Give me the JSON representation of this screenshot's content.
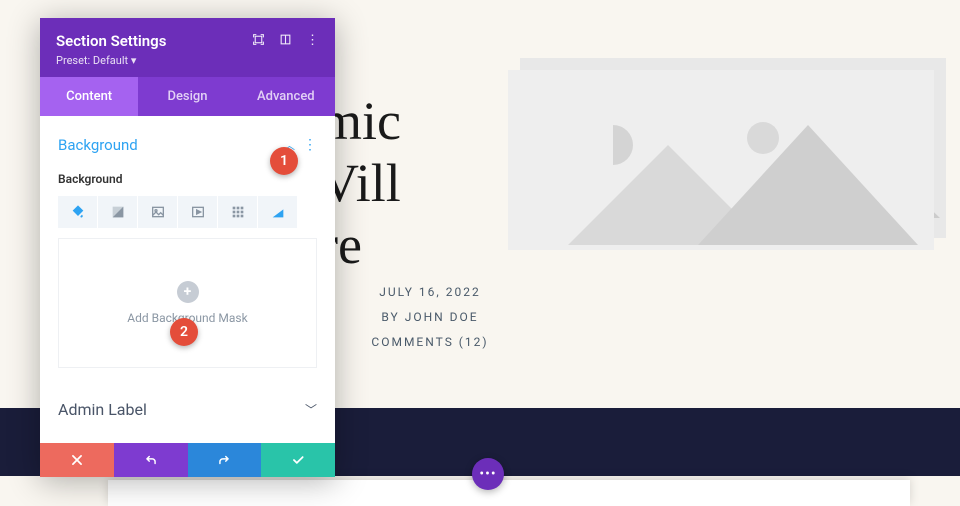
{
  "page": {
    "title_fragments": "mic\nVill\nre",
    "meta_date": "JULY 16, 2022",
    "meta_author": "BY JOHN DOE",
    "meta_comments": "COMMENTS (12)"
  },
  "panel": {
    "title": "Section Settings",
    "preset": "Preset: Default ▾",
    "tabs": {
      "content": "Content",
      "design": "Design",
      "advanced": "Advanced"
    },
    "background_section": {
      "heading": "Background",
      "field_label": "Background",
      "add_mask_label": "Add Background Mask"
    },
    "admin_label": "Admin Label"
  },
  "annotations": {
    "one": "1",
    "two": "2"
  },
  "fab": "•••",
  "colors": {
    "accent_purple": "#6c2eb9",
    "accent_blue": "#2ea3f2",
    "badge_red": "#e44d3a"
  }
}
